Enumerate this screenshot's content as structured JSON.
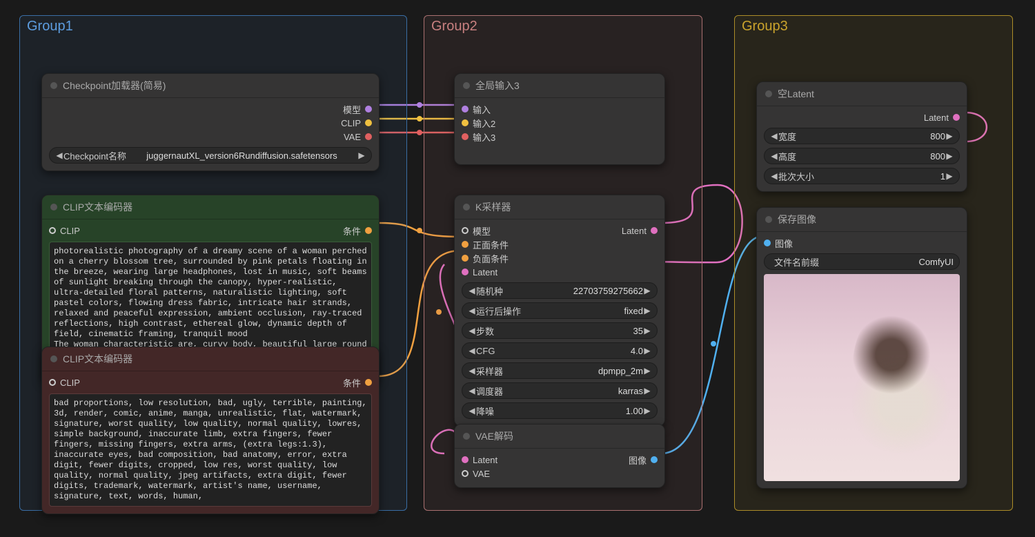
{
  "groups": {
    "g1": {
      "title": "Group1"
    },
    "g2": {
      "title": "Group2"
    },
    "g3": {
      "title": "Group3"
    }
  },
  "checkpoint": {
    "title": "Checkpoint加载器(简易)",
    "out_model": "模型",
    "out_clip": "CLIP",
    "out_vae": "VAE",
    "name_label": "Checkpoint名称",
    "name_value": "juggernautXL_version6Rundiffusion.safetensors"
  },
  "clip_pos": {
    "title": "CLIP文本编码器",
    "in_clip": "CLIP",
    "out_cond": "条件",
    "text": "photorealistic photography of a dreamy scene of a woman perched on a cherry blossom tree, surrounded by pink petals floating in the breeze, wearing large headphones, lost in music, soft beams of sunlight breaking through the canopy, hyper-realistic, ultra-detailed floral patterns, naturalistic lighting, soft pastel colors, flowing dress fabric, intricate hair strands, relaxed and peaceful expression, ambient occlusion, ray-traced reflections, high contrast, ethereal glow, dynamic depth of field, cinematic framing, tranquil mood\nThe woman characteristic are, curvy body, beautiful large round eyes, large breasts,   black hair, long bangs,  brown eyes. She is wearing necklace,"
  },
  "clip_neg": {
    "title": "CLIP文本编码器",
    "in_clip": "CLIP",
    "out_cond": "条件",
    "text": "bad proportions, low resolution, bad, ugly, terrible, painting, 3d, render, comic, anime, manga, unrealistic, flat, watermark, signature, worst quality, low quality, normal quality, lowres, simple background, inaccurate limb, extra fingers, fewer fingers, missing fingers, extra arms, (extra legs:1.3), inaccurate eyes, bad composition, bad anatomy, error, extra digit, fewer digits, cropped, low res, worst quality, low quality, normal quality, jpeg artifacts, extra digit, fewer digits, trademark, watermark, artist's name, username, signature, text, words, human,"
  },
  "reroute": {
    "title": "全局输入3",
    "in1": "输入",
    "in2": "输入2",
    "in3": "输入3"
  },
  "ksampler": {
    "title": "K采样器",
    "in_model": "模型",
    "in_pos": "正面条件",
    "in_neg": "负面条件",
    "in_latent": "Latent",
    "out_latent": "Latent",
    "seed_label": "随机种",
    "seed_value": "22703759275662",
    "after_label": "运行后操作",
    "after_value": "fixed",
    "steps_label": "步数",
    "steps_value": "35",
    "cfg_label": "CFG",
    "cfg_value": "4.0",
    "sampler_label": "采样器",
    "sampler_value": "dpmpp_2m",
    "sched_label": "调度器",
    "sched_value": "karras",
    "denoise_label": "降噪",
    "denoise_value": "1.00"
  },
  "vaedecode": {
    "title": "VAE解码",
    "in_latent": "Latent",
    "in_vae": "VAE",
    "out_img": "图像"
  },
  "empty_latent": {
    "title": "空Latent",
    "out_latent": "Latent",
    "w_label": "宽度",
    "w_value": "800",
    "h_label": "高度",
    "h_value": "800",
    "b_label": "批次大小",
    "b_value": "1"
  },
  "save": {
    "title": "保存图像",
    "in_img": "图像",
    "prefix_label": "文件名前缀",
    "prefix_value": "ComfyUI"
  },
  "preview_alt": "generated image: woman with headphones among cherry blossoms"
}
